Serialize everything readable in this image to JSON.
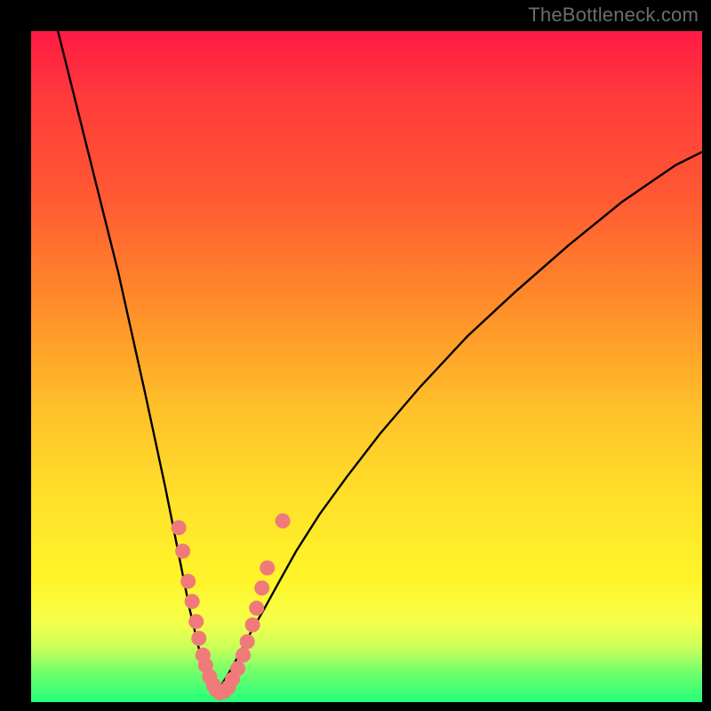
{
  "watermark": "TheBottleneck.com",
  "colors": {
    "curve": "#000000",
    "marker_fill": "#f07a7a",
    "marker_stroke": "#c95b5b"
  },
  "chart_data": {
    "type": "line",
    "title": "",
    "xlabel": "",
    "ylabel": "",
    "xlim": [
      0,
      100
    ],
    "ylim": [
      0,
      100
    ],
    "grid": false,
    "legend": false,
    "series": [
      {
        "name": "curve-left",
        "x": [
          4,
          7,
          10,
          13,
          15,
          17,
          18.5,
          20,
          21,
          22,
          22.8,
          23.6,
          24.3,
          25,
          25.7,
          26.3,
          26.8,
          27.3,
          27.8
        ],
        "y": [
          100,
          88,
          76,
          64,
          55,
          46,
          39,
          32,
          27,
          22,
          18,
          14,
          11,
          8,
          6,
          4,
          3,
          2.2,
          1.6
        ]
      },
      {
        "name": "curve-right",
        "x": [
          27.8,
          28.3,
          29,
          30,
          31.2,
          32.8,
          34.8,
          37,
          39.5,
          43,
          47,
          52,
          58,
          65,
          72,
          80,
          88,
          96,
          100
        ],
        "y": [
          1.6,
          2.4,
          3.6,
          5.2,
          7.5,
          10.5,
          14,
          18,
          22.5,
          28,
          33.5,
          40,
          47,
          54.5,
          61,
          68,
          74.5,
          80,
          82
        ]
      }
    ],
    "markers": [
      {
        "x": 22.0,
        "y": 26.0
      },
      {
        "x": 22.6,
        "y": 22.5
      },
      {
        "x": 23.4,
        "y": 18.0
      },
      {
        "x": 24.0,
        "y": 15.0
      },
      {
        "x": 24.6,
        "y": 12.0
      },
      {
        "x": 25.0,
        "y": 9.5
      },
      {
        "x": 25.6,
        "y": 7.0
      },
      {
        "x": 26.0,
        "y": 5.5
      },
      {
        "x": 26.6,
        "y": 3.8
      },
      {
        "x": 27.2,
        "y": 2.5
      },
      {
        "x": 27.6,
        "y": 1.8
      },
      {
        "x": 28.2,
        "y": 1.4
      },
      {
        "x": 28.8,
        "y": 1.6
      },
      {
        "x": 29.4,
        "y": 2.2
      },
      {
        "x": 30.0,
        "y": 3.4
      },
      {
        "x": 30.8,
        "y": 5.0
      },
      {
        "x": 31.6,
        "y": 7.0
      },
      {
        "x": 32.2,
        "y": 9.0
      },
      {
        "x": 33.0,
        "y": 11.5
      },
      {
        "x": 33.6,
        "y": 14.0
      },
      {
        "x": 34.4,
        "y": 17.0
      },
      {
        "x": 35.2,
        "y": 20.0
      },
      {
        "x": 37.5,
        "y": 27.0
      }
    ]
  }
}
